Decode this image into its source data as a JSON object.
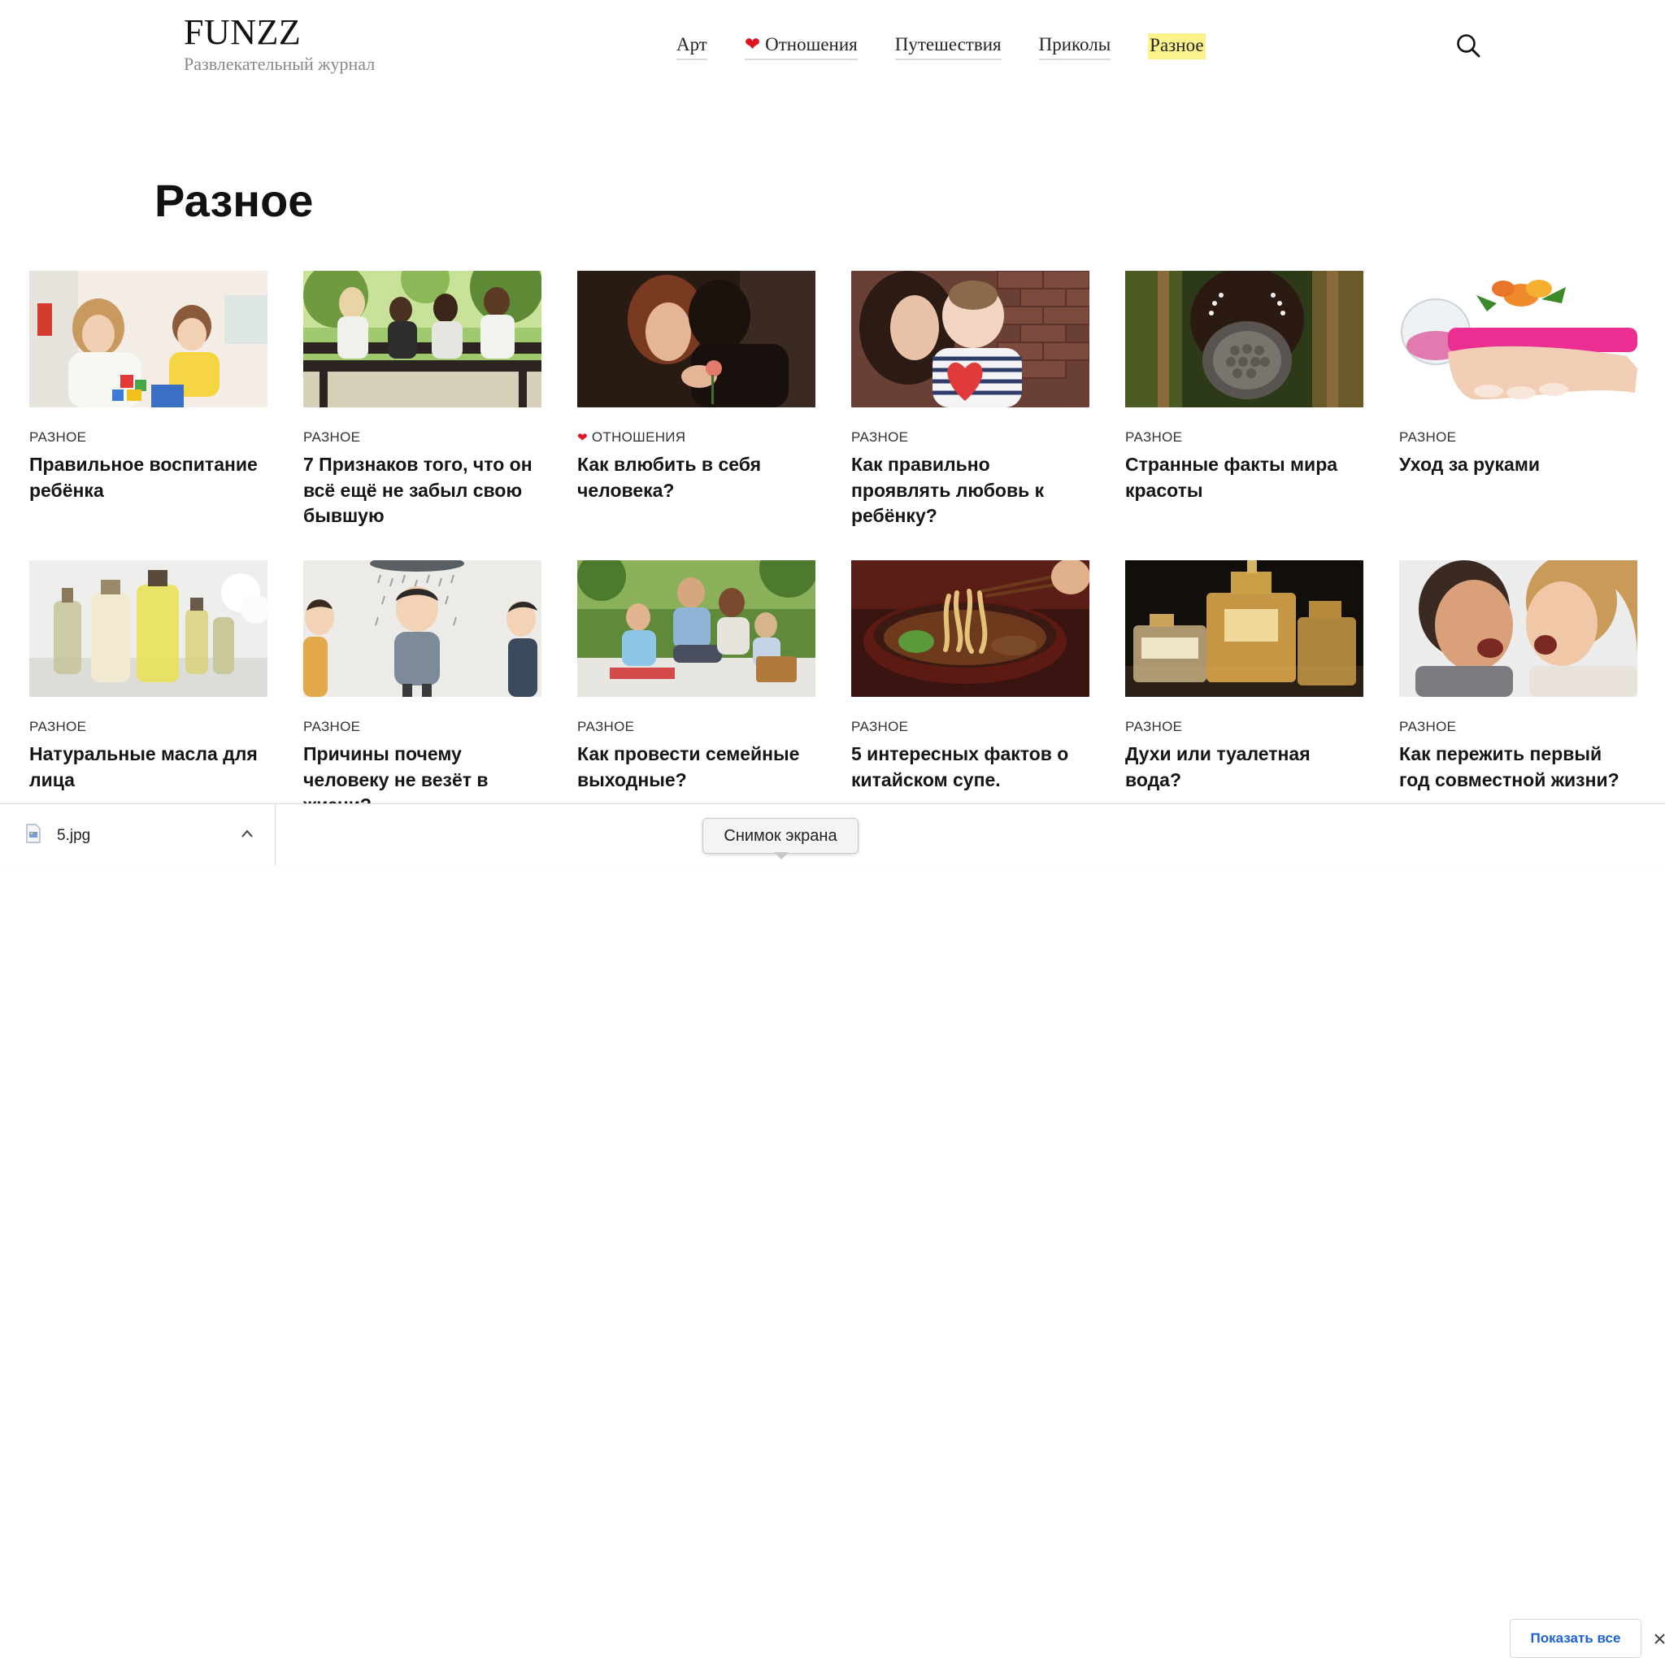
{
  "site": {
    "name": "FUNZZ",
    "tagline": "Развлекательный журнал"
  },
  "nav": {
    "items": [
      {
        "label": "Арт"
      },
      {
        "label": "Отношения",
        "icon": "heart-icon"
      },
      {
        "label": "Путешествия"
      },
      {
        "label": "Приколы"
      },
      {
        "label": "Разное",
        "active": true
      }
    ],
    "search_icon": "search-icon"
  },
  "page": {
    "title": "Разное"
  },
  "articles": [
    {
      "category": "РАЗНОЕ",
      "title": "Правильное воспитание ребёнка",
      "image": "mother-and-child-playing-blocks"
    },
    {
      "category": "РАЗНОЕ",
      "title": "7 Признаков того, что он всё ещё не забыл свою бывшую",
      "image": "couples-on-park-bench"
    },
    {
      "category": "ОТНОШЕНИЯ",
      "category_icon": "heart-icon",
      "title": "Как влюбить в себя человека?",
      "image": "couple-embracing-with-rose"
    },
    {
      "category": "РАЗНОЕ",
      "title": "Как правильно проявлять любовь к ребёнку?",
      "image": "mother-kissing-baby"
    },
    {
      "category": "РАЗНОЕ",
      "title": "Странные факты мира красоты",
      "image": "woman-with-lip-plate"
    },
    {
      "category": "РАЗНОЕ",
      "title": "Уход за руками",
      "image": "hands-with-flowers"
    },
    {
      "category": "РАЗНОЕ",
      "title": "Натуральные масла для лица",
      "image": "oil-bottles"
    },
    {
      "category": "РАЗНОЕ",
      "title": "Причины почему человеку не везёт в жизни?",
      "image": "cartoon-man-under-rain-cloud"
    },
    {
      "category": "РАЗНОЕ",
      "title": "Как провести семейные выходные?",
      "image": "family-picnic"
    },
    {
      "category": "РАЗНОЕ",
      "title": "5 интересных фактов о китайском супе.",
      "image": "noodle-soup-bowl"
    },
    {
      "category": "РАЗНОЕ",
      "title": "Духи или туалетная вода?",
      "image": "perfume-bottles"
    },
    {
      "category": "РАЗНОЕ",
      "title": "Как пережить первый год совместной жизни?",
      "image": "couple-arguing"
    }
  ],
  "download_bar": {
    "file_name": "5.jpg",
    "tooltip": "Снимок экрана",
    "show_all_label": "Показать все"
  },
  "colors": {
    "active_nav_highlight": "#fcf38d",
    "heart": "#e0131f",
    "show_all_link": "#1a62d6"
  }
}
